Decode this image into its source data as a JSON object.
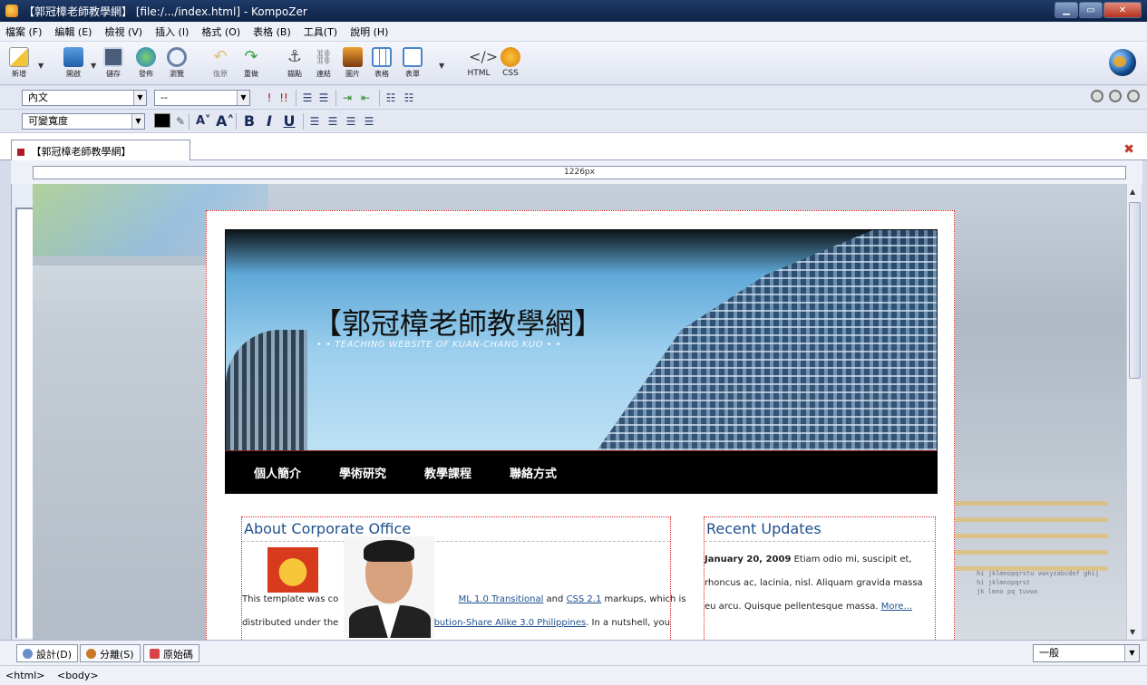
{
  "window": {
    "title": "【郭冠樟老師教學網】 [file:/.../index.html] - KompoZer"
  },
  "menu": [
    "檔案 (F)",
    "編輯 (E)",
    "檢視 (V)",
    "插入 (I)",
    "格式 (O)",
    "表格 (B)",
    "工具(T)",
    "說明 (H)"
  ],
  "toolbar": {
    "new": "新增",
    "open": "開啟",
    "save": "儲存",
    "publish": "發佈",
    "browse": "瀏覽",
    "undo": "復原",
    "redo": "重做",
    "anchor": "錨點",
    "link": "連結",
    "image": "圖片",
    "table": "表格",
    "form": "表單",
    "html": "HTML",
    "css": "CSS"
  },
  "format1": {
    "paragraph": "內文",
    "font": "--"
  },
  "format2": {
    "width": "可變寬度"
  },
  "document_tab": {
    "label": "【郭冠樟老師教學網】"
  },
  "ruler": {
    "width_label": "1226px"
  },
  "page": {
    "site_title": "【郭冠樟老師教學網】",
    "site_subtitle": "• • TEACHING WEBSITE OF KUAN-CHANG KUO • •",
    "nav": [
      "個人簡介",
      "學術研究",
      "教學課程",
      "聯絡方式"
    ],
    "left_heading": "About Corporate Office",
    "left_line1_a": "This template was co",
    "left_line1_link1": "ML 1.0 Transitional",
    "left_line1_b": "and",
    "left_line1_link2": "CSS 2.1",
    "left_line1_c": "markups, which is",
    "left_line2_a": "distributed under the",
    "left_line2_link": "ribution-Share Alike 3.0 Philippines",
    "left_line2_b": ". In a nutshell, you",
    "right_heading": "Recent Updates",
    "right_date": "January 20, 2009",
    "right_line1": "Etiam odio mi, suscipit et,",
    "right_line2": "rhoncus ac, lacinia, nisl. Aliquam gravida massa",
    "right_line3": "eu arcu. Quisque pellentesque massa.",
    "right_more": "More..."
  },
  "bottom_tabs": {
    "design": "設計(D)",
    "split": "分離(S)",
    "source": "原始碼"
  },
  "mode_select": "一般",
  "status": [
    "<html>",
    "<body>"
  ],
  "colors": {
    "titlebar": "#0e2348",
    "nav_bg": "#000000",
    "heading": "#1d4f8c",
    "dotted_border": "#dd2222"
  }
}
